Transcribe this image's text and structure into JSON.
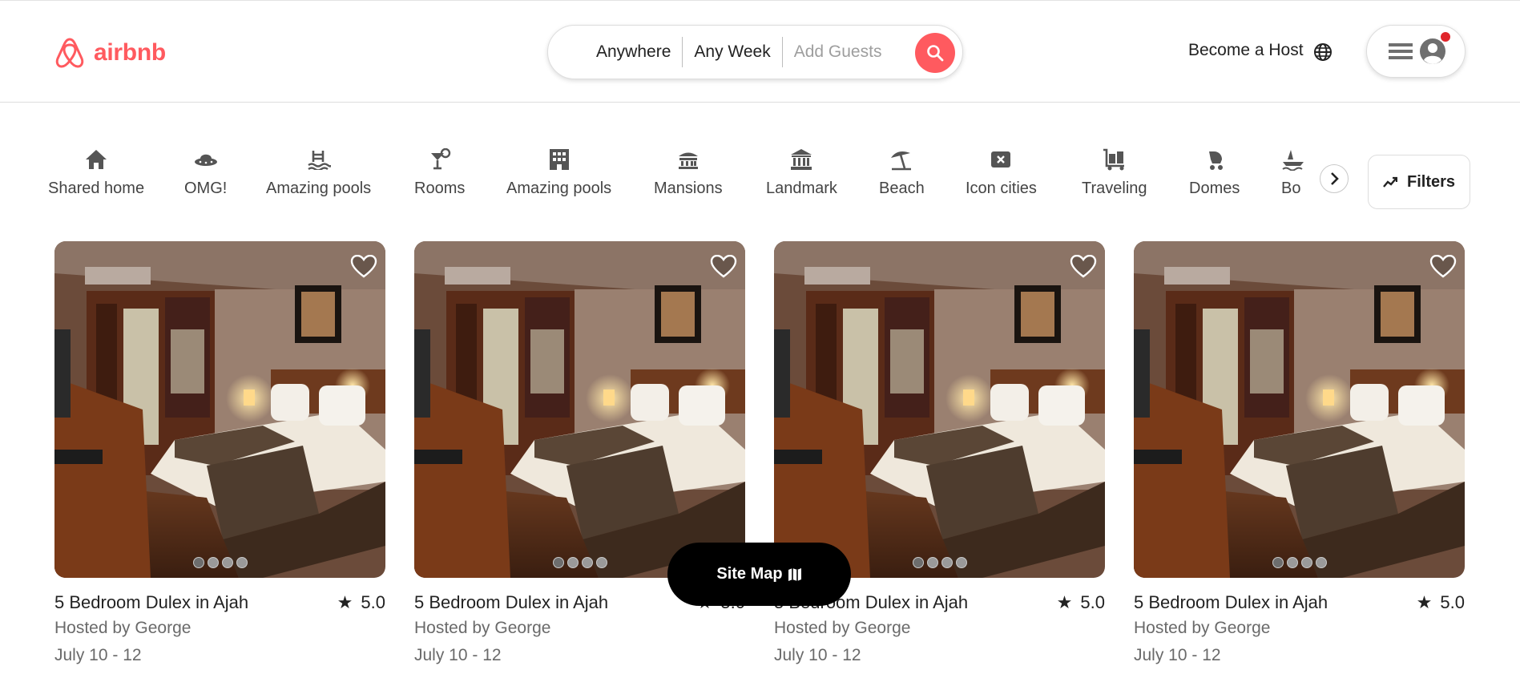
{
  "brand": {
    "name": "airbnb",
    "color": "#ff5a5f"
  },
  "search": {
    "where": "Anywhere",
    "when": "Any Week",
    "guests_placeholder": "Add Guests",
    "icon": "search-icon"
  },
  "header": {
    "host_link": "Become a Host",
    "globe_icon": "globe-icon",
    "menu_icon": "hamburger-icon",
    "avatar_icon": "user-avatar-icon",
    "notification_color": "#e0252b"
  },
  "categories": [
    {
      "label": "Shared home",
      "icon": "home-icon"
    },
    {
      "label": "OMG!",
      "icon": "ufo-icon"
    },
    {
      "label": "Amazing pools",
      "icon": "pool-icon"
    },
    {
      "label": "Rooms",
      "icon": "cocktail-icon"
    },
    {
      "label": "Amazing pools",
      "icon": "building-icon"
    },
    {
      "label": "Mansions",
      "icon": "mansion-icon"
    },
    {
      "label": "Landmark",
      "icon": "landmark-icon"
    },
    {
      "label": "Beach",
      "icon": "umbrella-icon"
    },
    {
      "label": "Icon cities",
      "icon": "city-icon"
    },
    {
      "label": "Traveling",
      "icon": "luggage-icon"
    },
    {
      "label": "Domes",
      "icon": "stroller-icon"
    },
    {
      "label": "Bo",
      "icon": "boat-icon"
    }
  ],
  "filters": {
    "label": "Filters",
    "icon": "trend-icon"
  },
  "listings": [
    {
      "title": "5 Bedroom Dulex in Ajah",
      "rating": "5.0",
      "host": "Hosted by George",
      "dates": "July 10 - 12"
    },
    {
      "title": "5 Bedroom Dulex in Ajah",
      "rating": "5.0",
      "host": "Hosted by George",
      "dates": "July 10 - 12"
    },
    {
      "title": "5 Bedroom Dulex in Ajah",
      "rating": "5.0",
      "host": "Hosted by George",
      "dates": "July 10 - 12"
    },
    {
      "title": "5 Bedroom Dulex in Ajah",
      "rating": "5.0",
      "host": "Hosted by George",
      "dates": "July 10 - 12"
    }
  ],
  "site_map": {
    "label": "Site Map",
    "icon": "map-icon"
  }
}
